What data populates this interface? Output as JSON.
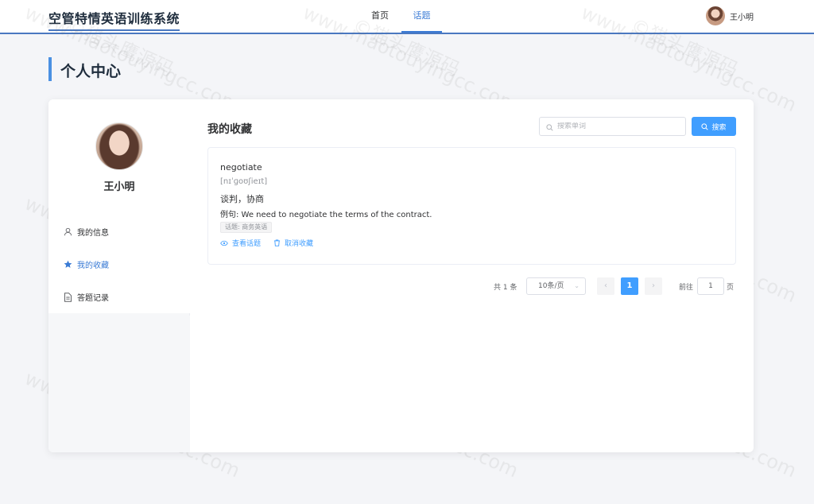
{
  "app": {
    "title": "空管特情英语训练系统"
  },
  "nav": {
    "items": [
      {
        "label": "首页"
      },
      {
        "label": "话题"
      }
    ],
    "active": "话题"
  },
  "user": {
    "name": "王小明"
  },
  "page": {
    "title": "个人中心"
  },
  "sidebar": {
    "name": "王小明",
    "items": [
      {
        "label": "我的信息",
        "icon": "user-icon"
      },
      {
        "label": "我的收藏",
        "icon": "star-icon",
        "active": true
      },
      {
        "label": "答题记录",
        "icon": "document-icon"
      }
    ]
  },
  "content": {
    "title": "我的收藏",
    "search": {
      "placeholder": "搜索单词",
      "button_label": "搜索"
    },
    "favorites": [
      {
        "word": "negotiate",
        "phonetic": "[nɪˈɡoʊʃieɪt]",
        "meaning": "谈判，协商",
        "example": "例句: We need to negotiate the terms of the contract.",
        "tag": "话题: 商务英语",
        "view_label": "查看话题",
        "unfav_label": "取消收藏"
      }
    ],
    "pagination": {
      "total": "共 1 条",
      "page_size": "10条/页",
      "current_page": "1",
      "goto_prefix": "前往",
      "goto_value": "1",
      "goto_suffix": "页"
    }
  },
  "watermark": {
    "cn": "©猫头鹰源码",
    "url": "www.maotouyingcc.com"
  },
  "colors": {
    "accent": "#409eff",
    "brand_line": "#4a78c0"
  }
}
